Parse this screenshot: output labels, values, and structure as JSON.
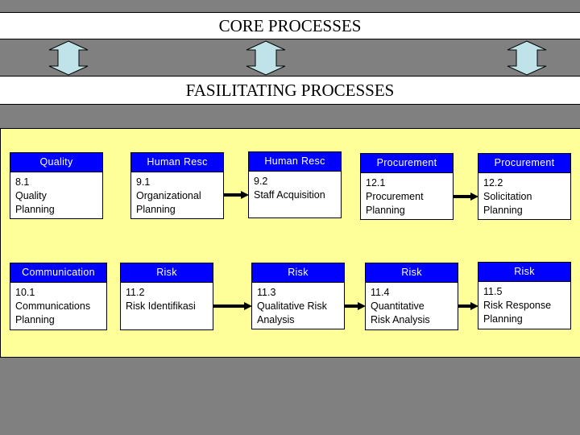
{
  "bands": {
    "core": "CORE PROCESSES",
    "facilitating": "FASILITATING PROCESSES"
  },
  "connector_arrows": {
    "count": 3,
    "direction": "bidirectional-vertical",
    "fill_color": "#bfe3e8"
  },
  "colors": {
    "background": "#808080",
    "panel": "#ffff99",
    "header": "#0000ff",
    "header_text": "#ffffff",
    "band": "#ffffff"
  },
  "rows": [
    {
      "boxes": [
        {
          "category": "Quality",
          "number": "8.1",
          "lines": [
            "Quality",
            "Planning"
          ]
        },
        {
          "category": "Human Resc",
          "number": "9.1",
          "lines": [
            "Organizational",
            "Planning"
          ]
        },
        {
          "category": "Human Resc",
          "number": "9.2",
          "lines": [
            "Staff Acquisition"
          ]
        },
        {
          "category": "Procurement",
          "number": "12.1",
          "lines": [
            "Procurement",
            "Planning"
          ]
        },
        {
          "category": "Procurement",
          "number": "12.2",
          "lines": [
            "Solicitation",
            "Planning"
          ]
        }
      ],
      "flows": [
        [
          "9.1",
          "9.2"
        ],
        [
          "12.1",
          "12.2"
        ]
      ]
    },
    {
      "boxes": [
        {
          "category": "Communication",
          "number": "10.1",
          "lines": [
            "Communications",
            "Planning"
          ]
        },
        {
          "category": "Risk",
          "number": "11.2",
          "lines": [
            "Risk Identifikasi"
          ]
        },
        {
          "category": "Risk",
          "number": "11.3",
          "lines": [
            "Qualitative Risk",
            "Analysis"
          ]
        },
        {
          "category": "Risk",
          "number": "11.4",
          "lines": [
            "Quantitative",
            "Risk Analysis"
          ]
        },
        {
          "category": "Risk",
          "number": "11.5",
          "lines": [
            "Risk Response",
            "Planning"
          ]
        }
      ],
      "flows": [
        [
          "11.2",
          "11.3"
        ],
        [
          "11.3",
          "11.4"
        ],
        [
          "11.4",
          "11.5"
        ]
      ]
    }
  ]
}
